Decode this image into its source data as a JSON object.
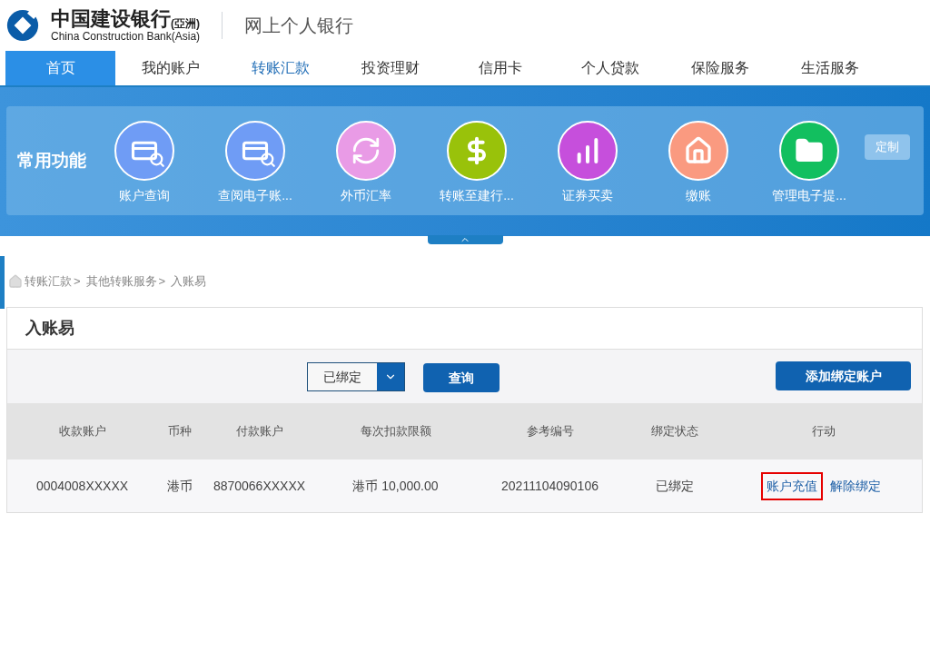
{
  "header": {
    "brand_cn": "中国建设银行",
    "brand_suffix": "(亞洲)",
    "brand_en": "China Construction Bank(Asia)",
    "product": "网上个人银行"
  },
  "nav": [
    {
      "label": "首页",
      "selected": true,
      "current": false
    },
    {
      "label": "我的账户",
      "selected": false,
      "current": false
    },
    {
      "label": "转账汇款",
      "selected": false,
      "current": true
    },
    {
      "label": "投资理财",
      "selected": false,
      "current": false
    },
    {
      "label": "信用卡",
      "selected": false,
      "current": false
    },
    {
      "label": "个人贷款",
      "selected": false,
      "current": false
    },
    {
      "label": "保险服务",
      "selected": false,
      "current": false
    },
    {
      "label": "生活服务",
      "selected": false,
      "current": false
    }
  ],
  "shortcuts": {
    "title": "常用功能",
    "customize": "定制",
    "items": [
      {
        "label": "账户查询",
        "kind": "card",
        "color": "#6f9cf5"
      },
      {
        "label": "查阅电子账...",
        "kind": "card",
        "color": "#6f9cf5"
      },
      {
        "label": "外币汇率",
        "kind": "exchange",
        "color": "#e99be6"
      },
      {
        "label": "转账至建行...",
        "kind": "transfer",
        "color": "#99c20a"
      },
      {
        "label": "证券买卖",
        "kind": "stocks",
        "color": "#c64fdc"
      },
      {
        "label": "缴账",
        "kind": "bill",
        "color": "#fa9a80"
      },
      {
        "label": "管理电子提...",
        "kind": "folder",
        "color": "#12bf5f"
      }
    ]
  },
  "breadcrumb": [
    {
      "label": "转账汇款",
      "separator": ">"
    },
    {
      "label": "其他转账服务",
      "separator": ">"
    },
    {
      "label": "入账易"
    }
  ],
  "panel": {
    "title": "入账易",
    "filter": "已绑定",
    "query_button": "查询",
    "add_button": "添加绑定账户",
    "columns": [
      "收款账户",
      "币种",
      "付款账户",
      "每次扣款限额",
      "参考编号",
      "绑定状态",
      "行动"
    ],
    "rows": [
      {
        "cells": [
          "0004008XXXXX",
          "港币",
          "8870066XXXXX",
          "港币 10,000.00",
          "20211104090106",
          "已绑定"
        ],
        "actions": [
          {
            "label": "账户充值",
            "highlighted": true
          },
          {
            "label": "解除绑定",
            "highlighted": false
          }
        ]
      }
    ]
  }
}
